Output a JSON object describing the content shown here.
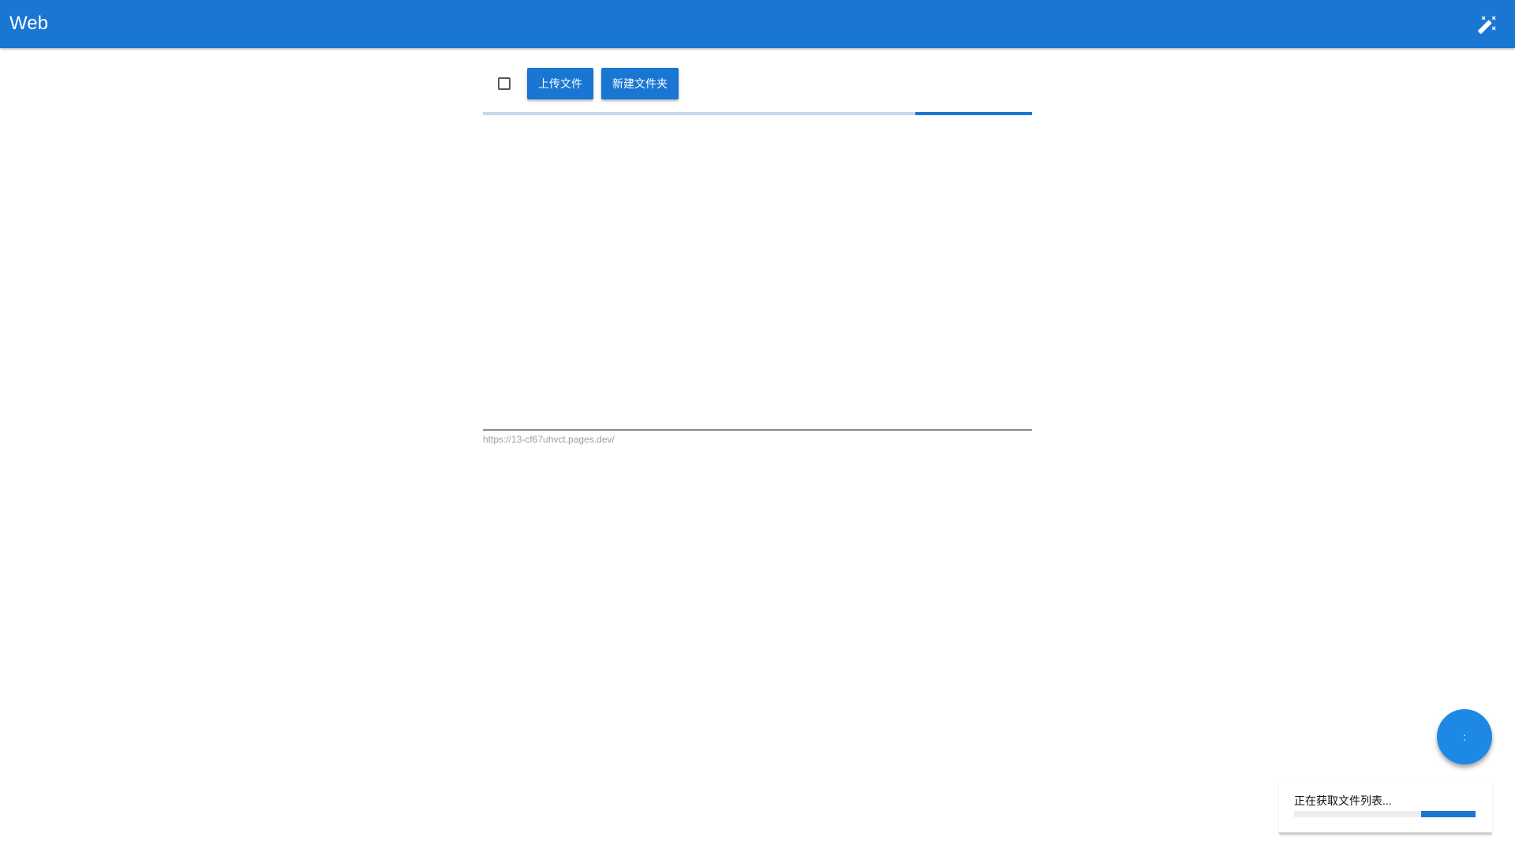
{
  "appbar": {
    "title": "Web",
    "theme_icon": "theme-toggle-icon"
  },
  "toolbar": {
    "select_all_icon": "checkbox-icon",
    "upload_label": "上传文件",
    "new_folder_label": "新建文件夹"
  },
  "top_progress": {
    "indeterminate": true
  },
  "url_field": {
    "value": "https://13-cf67uhvct.pages.dev/"
  },
  "fab": {
    "label": ":"
  },
  "toast": {
    "message": "正在获取文件列表...",
    "indeterminate": true
  },
  "colors": {
    "primary": "#1976d2",
    "primary_light": "#c5d9ef",
    "fab": "#1e88e5",
    "muted_text": "#9e9e9e"
  }
}
